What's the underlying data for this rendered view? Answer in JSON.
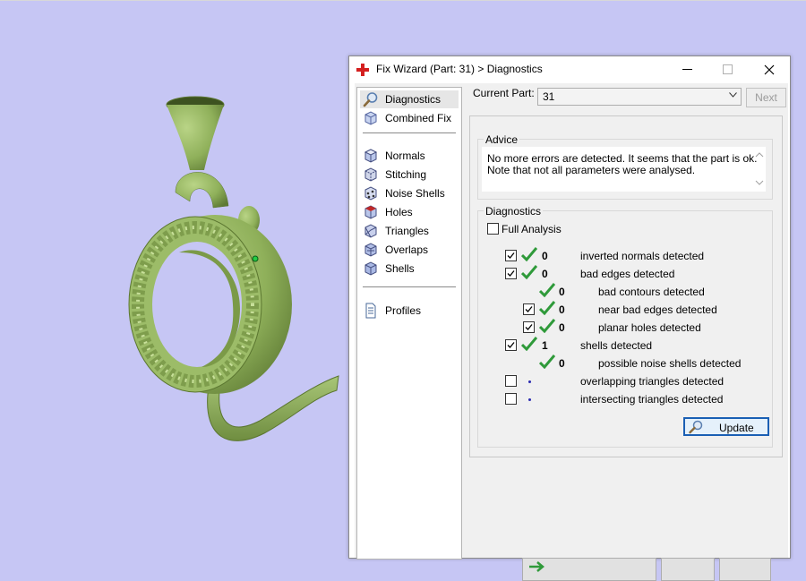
{
  "dialog": {
    "title": "Fix Wizard (Part: 31) > Diagnostics",
    "minimize_label": "minimize",
    "maximize_label": "maximize",
    "close_label": "close"
  },
  "nav": {
    "items": [
      {
        "label": "Diagnostics",
        "icon": "magnifier-icon"
      },
      {
        "label": "Combined Fix",
        "icon": "cube-icon"
      },
      {
        "label": "Normals",
        "icon": "normals-cube-icon"
      },
      {
        "label": "Stitching",
        "icon": "stitching-cube-icon"
      },
      {
        "label": "Noise Shells",
        "icon": "noise-shells-cube-icon"
      },
      {
        "label": "Holes",
        "icon": "holes-cube-icon"
      },
      {
        "label": "Triangles",
        "icon": "triangles-cube-icon"
      },
      {
        "label": "Overlaps",
        "icon": "overlaps-cube-icon"
      },
      {
        "label": "Shells",
        "icon": "shells-cube-icon"
      },
      {
        "label": "Profiles",
        "icon": "document-icon"
      }
    ]
  },
  "current_part": {
    "label": "Current Part:",
    "value": "31",
    "next_label": "Next"
  },
  "advice": {
    "title": "Advice",
    "line1": "No more errors are detected. It seems that the part is ok.",
    "line2": "Note that not all parameters were analysed."
  },
  "diagnostics": {
    "title": "Diagnostics",
    "full_analysis_label": "Full Analysis",
    "full_analysis_checked": false,
    "rows": [
      {
        "checked": true,
        "status": "ok",
        "count": "0",
        "label": "inverted normals detected"
      },
      {
        "checked": true,
        "status": "ok",
        "count": "0",
        "label": "bad edges detected"
      },
      {
        "checked": null,
        "status": "ok",
        "count": "0",
        "label": "bad contours detected"
      },
      {
        "checked": true,
        "status": "ok",
        "count": "0",
        "label": "near bad edges detected"
      },
      {
        "checked": true,
        "status": "ok",
        "count": "0",
        "label": "planar holes detected"
      },
      {
        "checked": true,
        "status": "ok",
        "count": "1",
        "label": "shells detected"
      },
      {
        "checked": null,
        "status": "ok",
        "count": "0",
        "label": "possible noise shells detected"
      },
      {
        "checked": false,
        "status": "pending",
        "count": "",
        "label": "overlapping triangles detected"
      },
      {
        "checked": false,
        "status": "pending",
        "count": "",
        "label": "intersecting triangles detected"
      }
    ],
    "update_label": "Update"
  },
  "colors": {
    "viewport_bg": "#c6c6f4",
    "model_green": "#8fb05a",
    "check_green": "#2f9a3a",
    "accent_blue": "#1a5fb4"
  }
}
